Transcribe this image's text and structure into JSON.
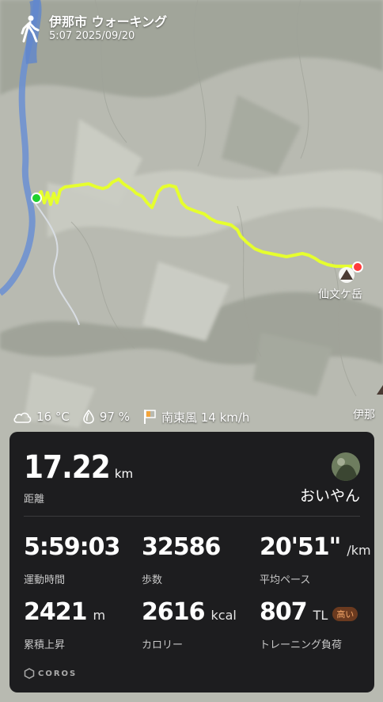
{
  "header": {
    "title": "伊那市 ウォーキング",
    "datetime": "5:07 2025/09/20"
  },
  "map": {
    "peak_label": "仙文ケ岳",
    "edge_label": "伊那"
  },
  "weather": {
    "temp": "16 °C",
    "humidity": "97 %",
    "wind": "南東風 14 km/h"
  },
  "summary": {
    "distance_value": "17.22",
    "distance_unit": "km",
    "distance_label": "距離",
    "username": "おいやん"
  },
  "stats": [
    {
      "value": "5:59:03",
      "unit": "",
      "label": "運動時間"
    },
    {
      "value": "32586",
      "unit": "",
      "label": "歩数"
    },
    {
      "value": "20'51\"",
      "unit": "/km",
      "label": "平均ペース"
    },
    {
      "value": "2421",
      "unit": "m",
      "label": "累積上昇"
    },
    {
      "value": "2616",
      "unit": "kcal",
      "label": "カロリー"
    },
    {
      "value": "807",
      "unit": "TL",
      "label": "トレーニング負荷",
      "badge": "高い"
    }
  ],
  "brand": "COROS",
  "colors": {
    "route": "#e6ff2e",
    "start": "#1fd12f",
    "end": "#ff3b3b",
    "river": "#6a8fd3"
  }
}
